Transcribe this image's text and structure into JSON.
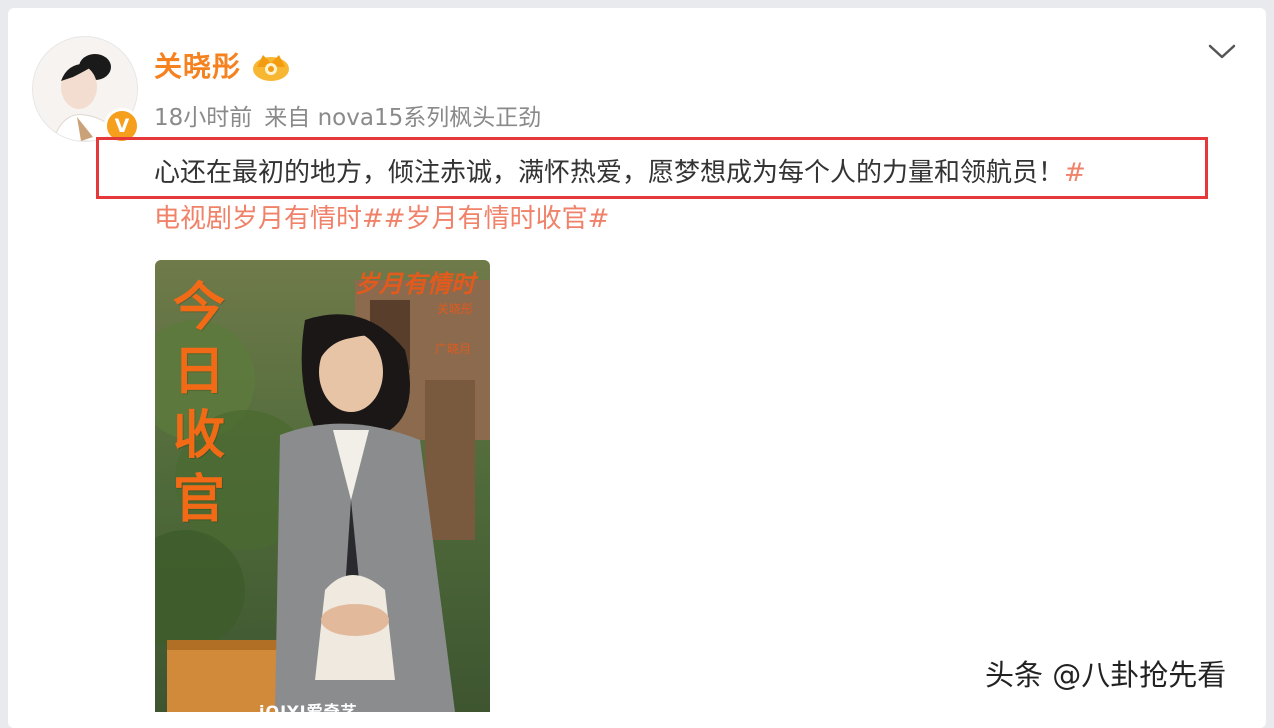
{
  "post": {
    "username": "关晓彤",
    "time": "18小时前",
    "source": "来自 nova15系列枫头正劲",
    "text_line1": "心还在最初的地方，倾注赤诚，满怀热爱，愿梦想成为每个人的力量和领航员！",
    "text_line1_tag_start": "#",
    "text_line2": "电视剧岁月有情时##岁月有情时收官#"
  },
  "poster": {
    "vertical_text": "今日收官",
    "title": "岁月有情时",
    "actor1": "关晓彤",
    "actor2": "广晓月",
    "logo_text": "iQIYI爱奇艺"
  },
  "icons": {
    "avatar_badge": "verified-v-icon",
    "crown": "crown-icon",
    "menu": "chevron-down-icon"
  },
  "colors": {
    "username": "#f5821f",
    "highlight_border": "#e5383b",
    "hashtag": "#f0826a",
    "badge": "#f59f1c"
  },
  "watermark": "头条 @八卦抢先看"
}
